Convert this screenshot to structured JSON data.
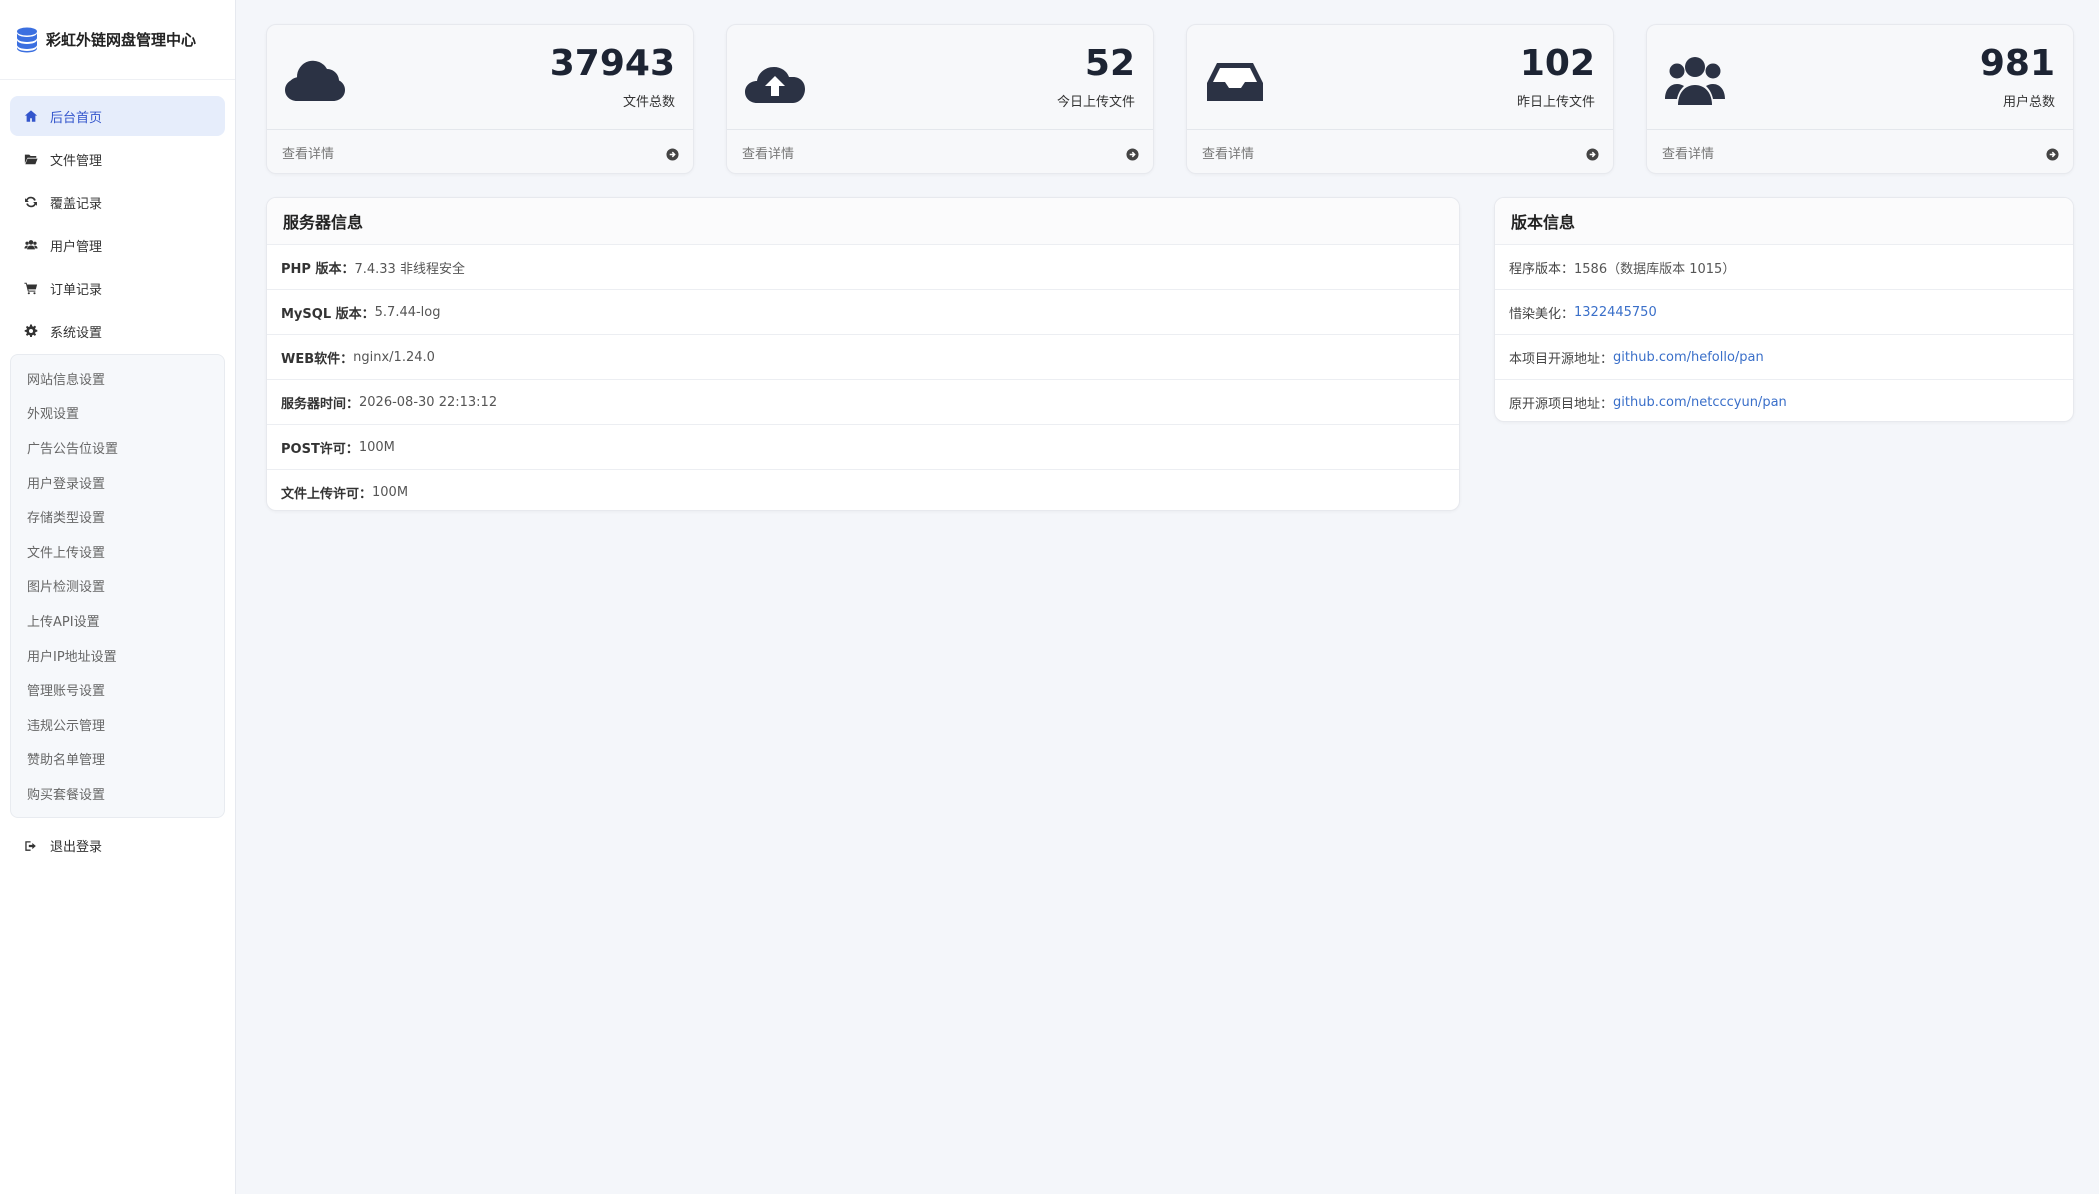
{
  "brand": {
    "title": "彩虹外链网盘管理中心",
    "icon": "database-icon"
  },
  "nav": {
    "items": [
      {
        "label": "后台首页",
        "icon": "home-icon",
        "active": true
      },
      {
        "label": "文件管理",
        "icon": "folder-open-icon"
      },
      {
        "label": "覆盖记录",
        "icon": "refresh-icon"
      },
      {
        "label": "用户管理",
        "icon": "users-icon"
      },
      {
        "label": "订单记录",
        "icon": "cart-icon"
      },
      {
        "label": "系统设置",
        "icon": "gear-icon"
      }
    ],
    "submenu": [
      "网站信息设置",
      "外观设置",
      "广告公告位设置",
      "用户登录设置",
      "存储类型设置",
      "文件上传设置",
      "图片检测设置",
      "上传API设置",
      "用户IP地址设置",
      "管理账号设置",
      "违规公示管理",
      "赞助名单管理",
      "购买套餐设置"
    ],
    "logout": {
      "label": "退出登录",
      "icon": "sign-out-icon"
    }
  },
  "stats": [
    {
      "value": "37943",
      "label": "文件总数",
      "link": "查看详情",
      "icon": "cloud-icon"
    },
    {
      "value": "52",
      "label": "今日上传文件",
      "link": "查看详情",
      "icon": "cloud-upload-icon"
    },
    {
      "value": "102",
      "label": "昨日上传文件",
      "link": "查看详情",
      "icon": "inbox-icon"
    },
    {
      "value": "981",
      "label": "用户总数",
      "link": "查看详情",
      "icon": "users-icon"
    }
  ],
  "server": {
    "title": "服务器信息",
    "rows": [
      {
        "key": "PHP 版本：",
        "value": "7.4.33 非线程安全"
      },
      {
        "key": "MySQL 版本：",
        "value": "5.7.44-log"
      },
      {
        "key": "WEB软件：",
        "value": "nginx/1.24.0"
      },
      {
        "key": "服务器时间：",
        "value": "2026-08-30 22:13:12"
      },
      {
        "key": "POST许可：",
        "value": "100M"
      },
      {
        "key": "文件上传许可：",
        "value": "100M"
      }
    ]
  },
  "version": {
    "title": "版本信息",
    "rows": [
      {
        "key": "程序版本：",
        "value": "1586（数据库版本 1015）"
      },
      {
        "key": "惜染美化：",
        "link": "1322445750"
      },
      {
        "key": "本项目开源地址：",
        "link": "github.com/hefollo/pan"
      },
      {
        "key": "原开源项目地址：",
        "link": "github.com/netcccyun/pan"
      }
    ]
  },
  "colors": {
    "accent": "#3355cc",
    "active_bg": "#e6edfb",
    "icon_dark": "#2b3244",
    "link": "#3a6fc9"
  }
}
